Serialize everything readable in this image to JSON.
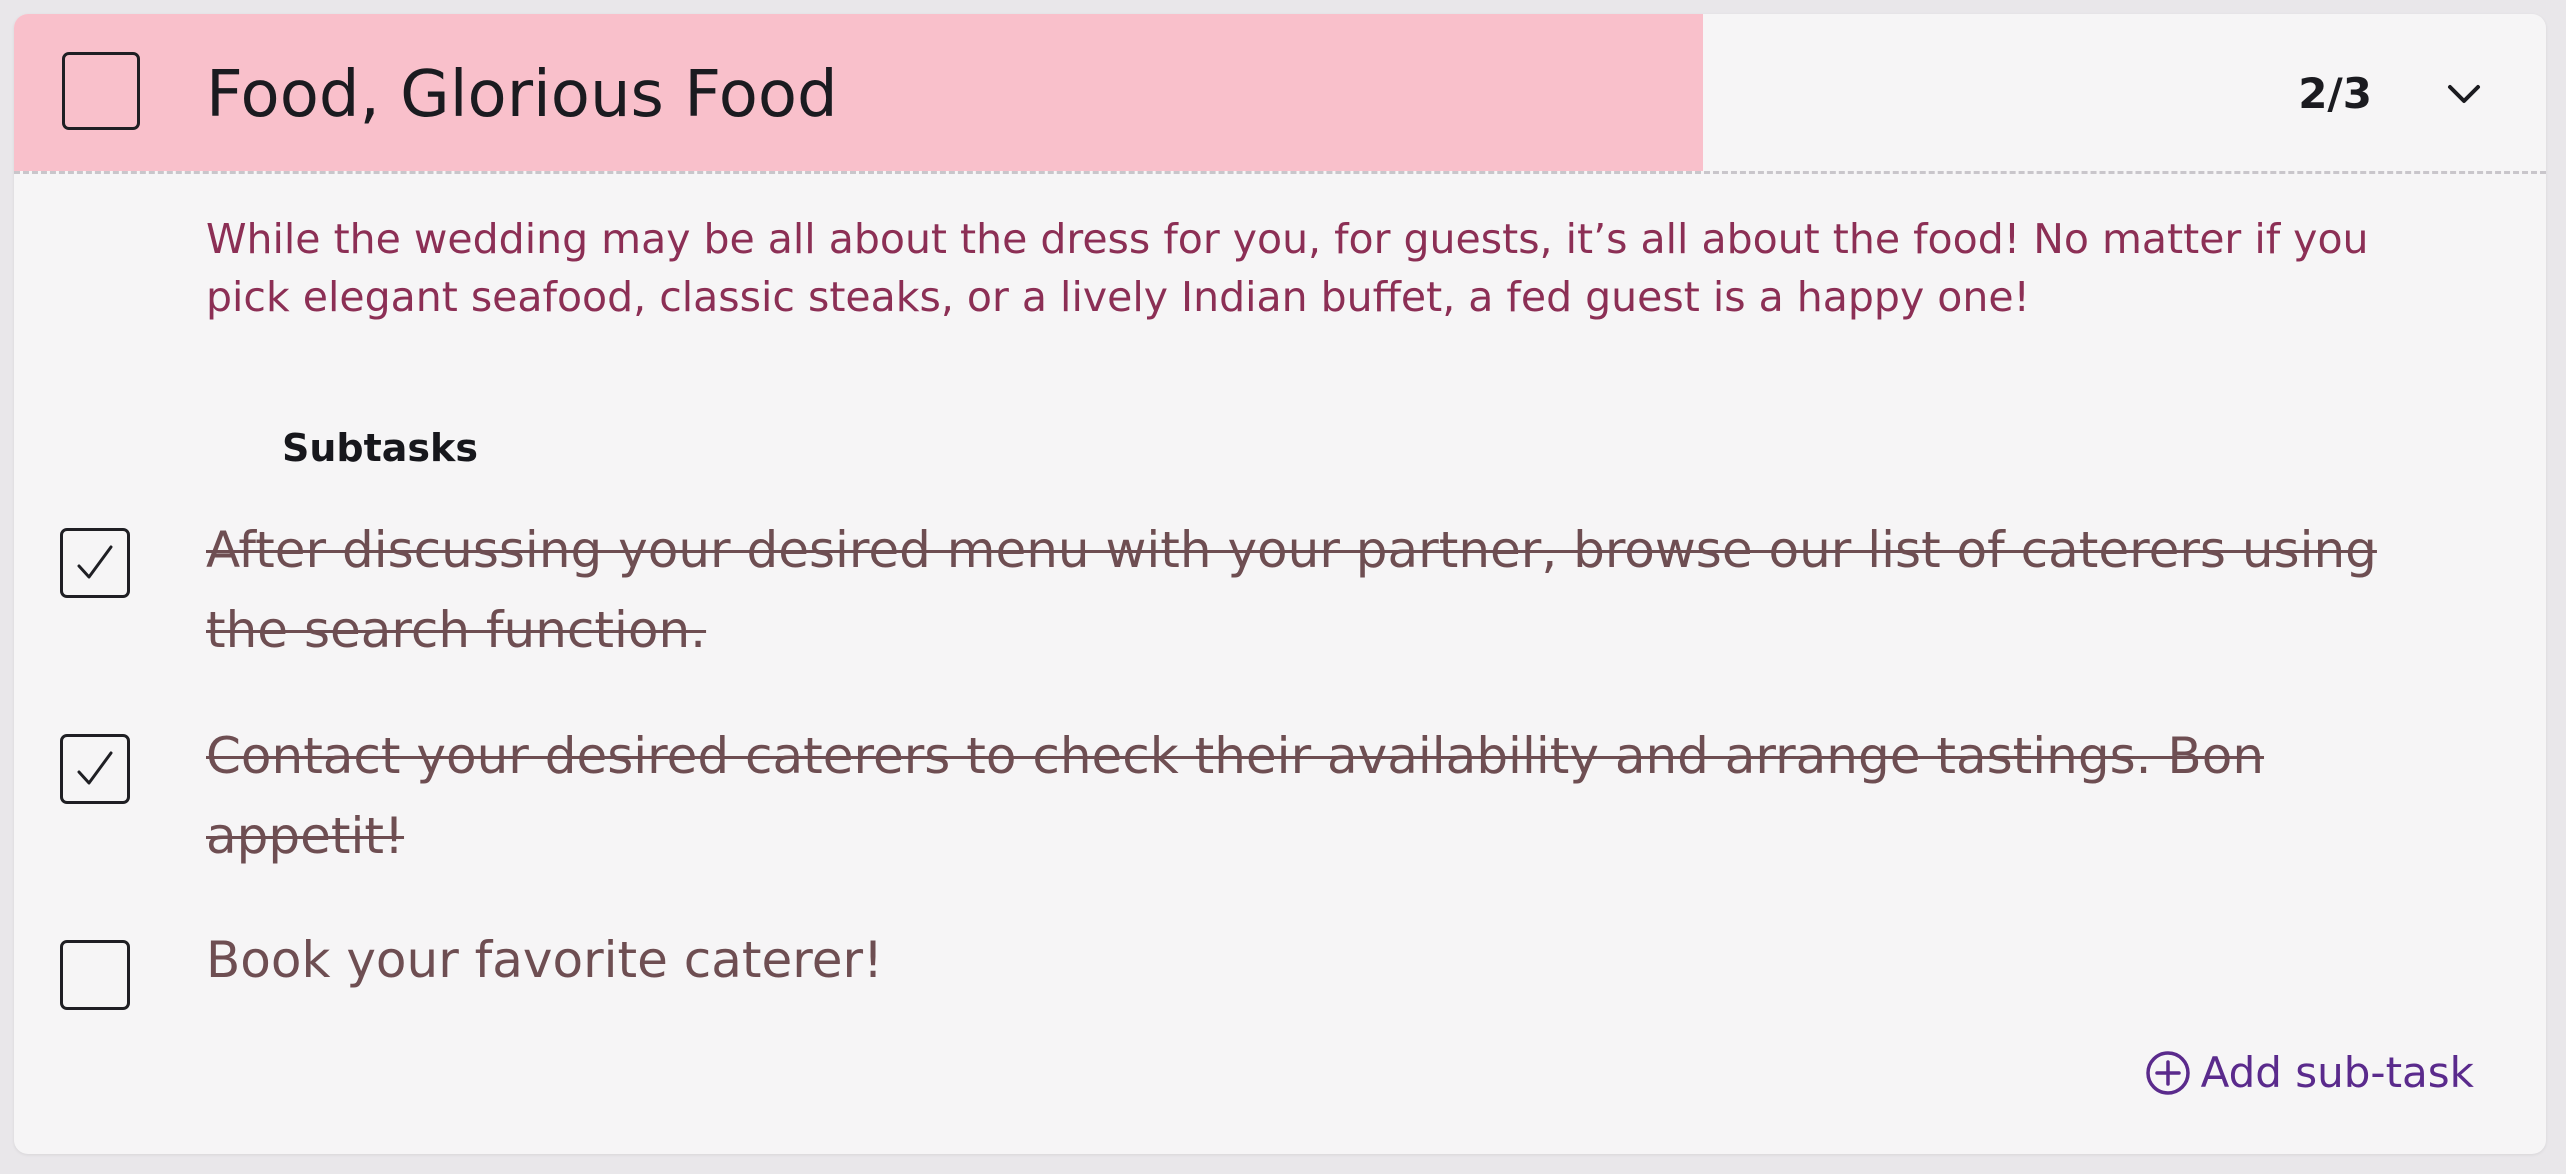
{
  "task": {
    "title": "Food, Glorious Food",
    "count": "2/3",
    "progress": 0.667,
    "description": "While the wedding may be all about the dress for you, for guests, it’s all about the food! No matter if you pick elegant seafood, classic steaks, or a lively Indian buffet, a fed guest is a happy one!"
  },
  "subtasks": {
    "heading": "Subtasks",
    "items": [
      {
        "text": "After discussing your desired menu with your partner, browse our list of caterers using the search function.",
        "done": true
      },
      {
        "text": "Contact your desired caterers to check their availability and arrange tastings. Bon appetit!",
        "done": true
      },
      {
        "text": "Book your favorite caterer!",
        "done": false
      }
    ],
    "add_label": "Add sub-task"
  },
  "icons": {
    "expand": "chevron-down-icon",
    "add": "plus-circle-icon",
    "check": "checkmark-icon"
  },
  "colors": {
    "progress": "#f9c0cb",
    "description": "#8c2f55",
    "subtask_text": "#6e4e52",
    "accent": "#5a2a8c"
  }
}
